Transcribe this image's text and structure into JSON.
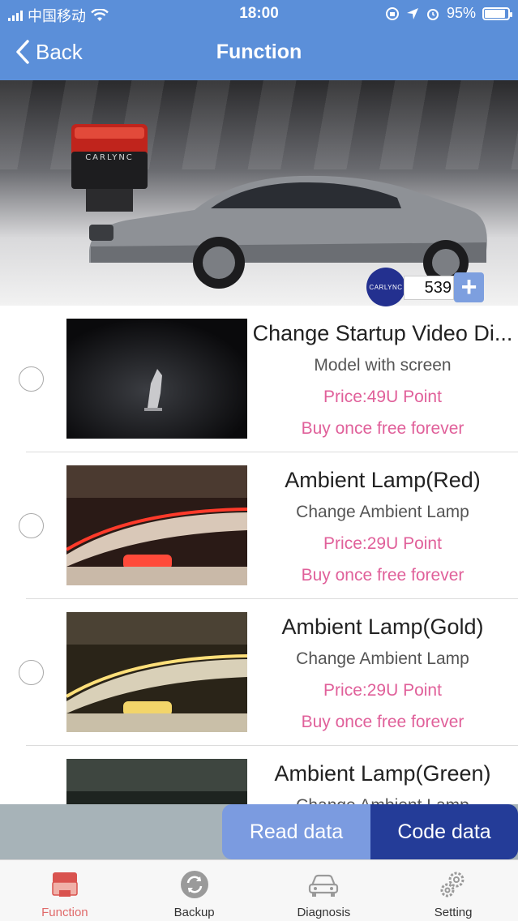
{
  "status_bar": {
    "carrier": "中国移动",
    "time": "18:00",
    "battery": "95%"
  },
  "nav": {
    "back_label": "Back",
    "title": "Function"
  },
  "banner": {
    "device_brand": "CARLYNC",
    "logo_text": "CARLYNC",
    "points": "539",
    "plus_label": "+"
  },
  "items": [
    {
      "title": "Change Startup Video Di...",
      "subtitle": "Model with screen",
      "price": "Price:49U Point",
      "note": "Buy once free forever"
    },
    {
      "title": "Ambient Lamp(Red)",
      "subtitle": "Change Ambient Lamp",
      "price": "Price:29U Point",
      "note": "Buy once free forever"
    },
    {
      "title": "Ambient Lamp(Gold)",
      "subtitle": "Change Ambient Lamp",
      "price": "Price:29U Point",
      "note": "Buy once free forever"
    },
    {
      "title": "Ambient Lamp(Green)",
      "subtitle": "Change Ambient Lamp",
      "price": "",
      "note": ""
    }
  ],
  "actions": {
    "read_label": "Read data",
    "code_label": "Code data"
  },
  "tabs": [
    {
      "label": "Function",
      "icon": "obd-device-icon",
      "active": true
    },
    {
      "label": "Backup",
      "icon": "refresh-icon",
      "active": false
    },
    {
      "label": "Diagnosis",
      "icon": "car-icon",
      "active": false
    },
    {
      "label": "Setting",
      "icon": "gear-icon",
      "active": false
    }
  ],
  "colors": {
    "header": "#5b8fd9",
    "price_text": "#e0609a",
    "read_button": "#7b9be0",
    "code_button": "#243c98",
    "active_tab": "#e06a6a"
  }
}
